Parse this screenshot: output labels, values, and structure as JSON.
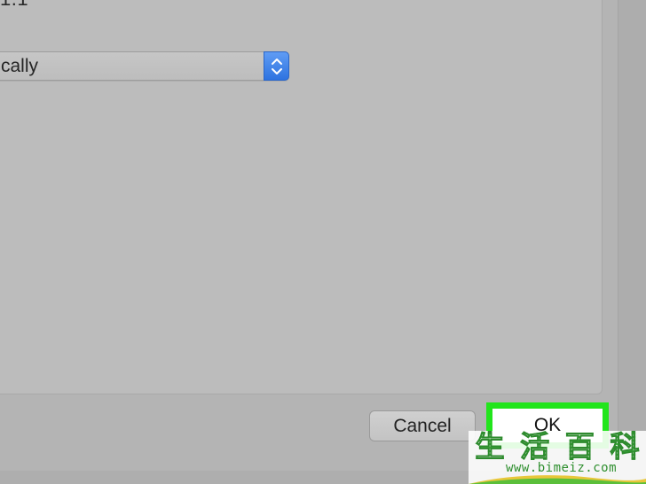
{
  "version_fragment": "1.1",
  "popup": {
    "selected_value": "cally"
  },
  "buttons": {
    "cancel_label": "Cancel",
    "ok_label": "OK"
  },
  "watermark": {
    "chars": [
      "生",
      "活",
      "百",
      "科"
    ],
    "url": "www.bimeiz.com"
  },
  "colors": {
    "highlight": "#22e51c",
    "stepper_blue": "#2e73e0",
    "watermark_green": "#3bb03b"
  }
}
